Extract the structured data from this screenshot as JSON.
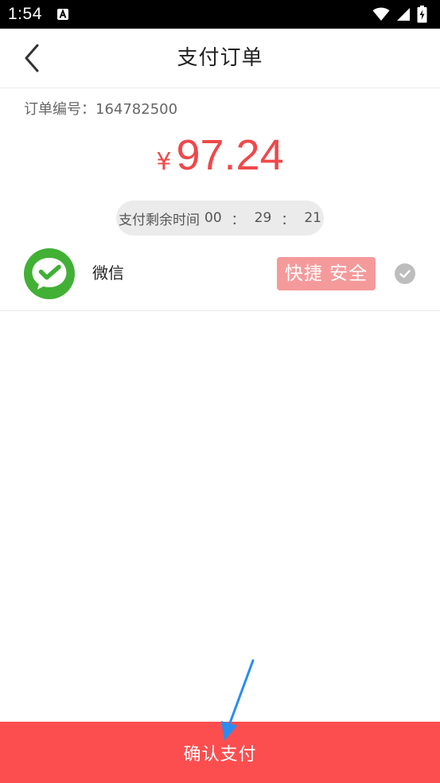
{
  "status_bar": {
    "time": "1:54",
    "icons": [
      "a-notification-icon",
      "wifi-icon",
      "signal-icon",
      "battery-charging-icon"
    ]
  },
  "header": {
    "title": "支付订单",
    "back_icon": "chevron-left-icon"
  },
  "order": {
    "number_label": "订单编号：",
    "number": "164782500",
    "currency": "¥",
    "amount": "97.24",
    "countdown_label": "支付剩余时间",
    "countdown_hours": "00",
    "countdown_minutes": "29",
    "countdown_seconds": "21",
    "countdown_separator": "："
  },
  "payment": {
    "method_name": "微信",
    "method_icon": "wechat-logo-icon",
    "badge": "快捷 安全",
    "selected": true
  },
  "footer": {
    "confirm_label": "确认支付"
  },
  "colors": {
    "accent": "#fd4e4f",
    "amount": "#f0484a",
    "badge": "#f59a9b",
    "wechat_green": "#41b035",
    "pill_bg": "#ebebeb",
    "arrow": "#2a8df0"
  }
}
